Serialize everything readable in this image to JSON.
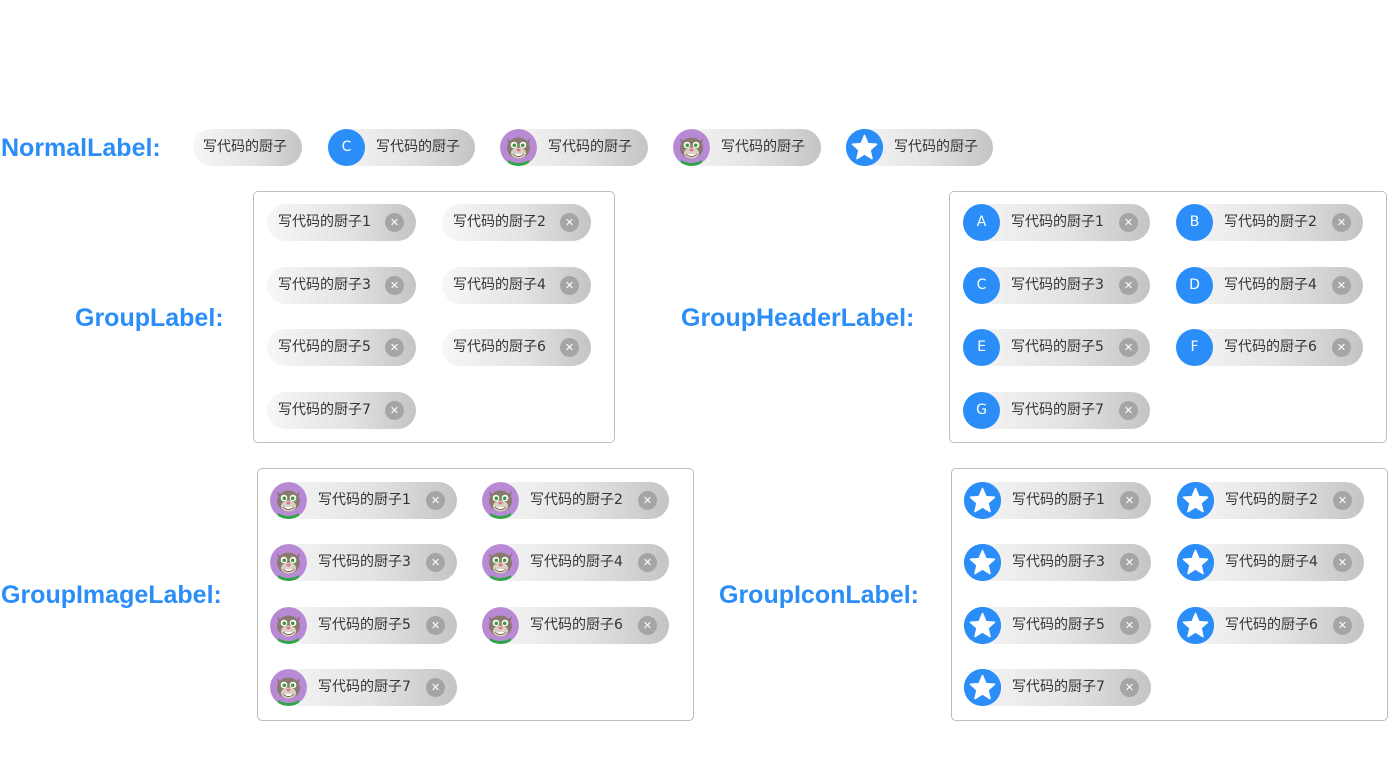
{
  "sections": {
    "normal_title": "NormalLabel:",
    "group_title": "GroupLabel:",
    "group_header_title": "GroupHeaderLabel:",
    "group_image_title": "GroupImageLabel:",
    "group_icon_title": "GroupIconLabel:"
  },
  "normal_labels": [
    {
      "text": "写代码的厨子",
      "kind": "plain"
    },
    {
      "text": "写代码的厨子",
      "kind": "header",
      "header": "C"
    },
    {
      "text": "写代码的厨子",
      "kind": "image",
      "image": "cat-avatar"
    },
    {
      "text": "写代码的厨子",
      "kind": "image",
      "image": "cat-avatar"
    },
    {
      "text": "写代码的厨子",
      "kind": "icon",
      "icon": "star-icon"
    }
  ],
  "group_labels": [
    "写代码的厨子1",
    "写代码的厨子2",
    "写代码的厨子3",
    "写代码的厨子4",
    "写代码的厨子5",
    "写代码的厨子6",
    "写代码的厨子7"
  ],
  "group_header_labels": [
    {
      "header": "A",
      "text": "写代码的厨子1"
    },
    {
      "header": "B",
      "text": "写代码的厨子2"
    },
    {
      "header": "C",
      "text": "写代码的厨子3"
    },
    {
      "header": "D",
      "text": "写代码的厨子4"
    },
    {
      "header": "E",
      "text": "写代码的厨子5"
    },
    {
      "header": "F",
      "text": "写代码的厨子6"
    },
    {
      "header": "G",
      "text": "写代码的厨子7"
    }
  ],
  "group_image_labels": [
    "写代码的厨子1",
    "写代码的厨子2",
    "写代码的厨子3",
    "写代码的厨子4",
    "写代码的厨子5",
    "写代码的厨子6",
    "写代码的厨子7"
  ],
  "group_icon_labels": [
    "写代码的厨子1",
    "写代码的厨子2",
    "写代码的厨子3",
    "写代码的厨子4",
    "写代码的厨子5",
    "写代码的厨子6",
    "写代码的厨子7"
  ],
  "close_glyph": "✕",
  "icons": {
    "close": "close-icon",
    "star": "star-icon",
    "avatar": "cat-avatar"
  },
  "colors": {
    "accent": "#2b8ef8",
    "chip_start": "#f7f7f7",
    "chip_end": "#c4c4c4",
    "close_bg": "#a5a5a5",
    "border": "#bdbdbd"
  }
}
